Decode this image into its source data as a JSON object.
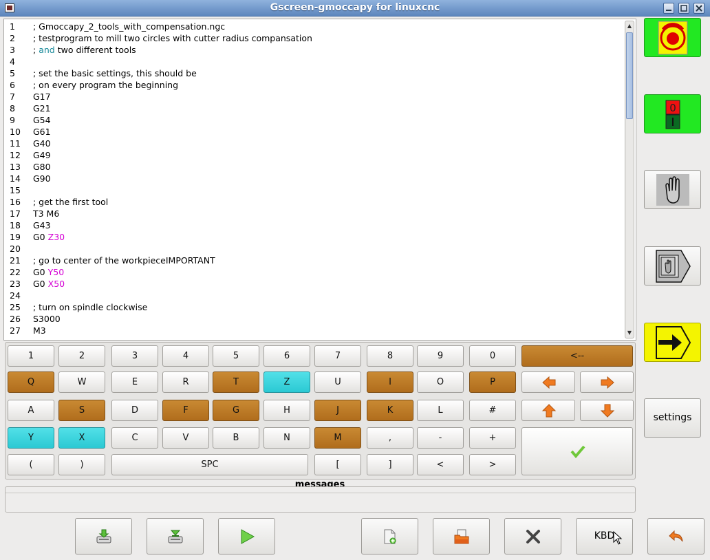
{
  "window": {
    "title": "Gscreen-gmoccapy for linuxcnc"
  },
  "editor": {
    "lines": [
      {
        "n": "1",
        "segs": [
          {
            "t": "; Gmoccapy_2_tools_with_compensation.ngc",
            "c": ""
          }
        ]
      },
      {
        "n": "2",
        "segs": [
          {
            "t": "; testprogram to mill two circles with cutter radius compansation",
            "c": ""
          }
        ]
      },
      {
        "n": "3",
        "segs": [
          {
            "t": "; ",
            "c": ""
          },
          {
            "t": "and",
            "c": "t"
          },
          {
            "t": " two different tools",
            "c": ""
          }
        ]
      },
      {
        "n": "4",
        "segs": [
          {
            "t": "",
            "c": ""
          }
        ]
      },
      {
        "n": "5",
        "segs": [
          {
            "t": "; set the basic settings, this should be",
            "c": ""
          }
        ]
      },
      {
        "n": "6",
        "segs": [
          {
            "t": "; on every program the beginning",
            "c": ""
          }
        ]
      },
      {
        "n": "7",
        "segs": [
          {
            "t": "G17",
            "c": ""
          }
        ]
      },
      {
        "n": "8",
        "segs": [
          {
            "t": "G21",
            "c": ""
          }
        ]
      },
      {
        "n": "9",
        "segs": [
          {
            "t": "G54",
            "c": ""
          }
        ]
      },
      {
        "n": "10",
        "segs": [
          {
            "t": "G61",
            "c": ""
          }
        ]
      },
      {
        "n": "11",
        "segs": [
          {
            "t": "G40",
            "c": ""
          }
        ]
      },
      {
        "n": "12",
        "segs": [
          {
            "t": "G49",
            "c": ""
          }
        ]
      },
      {
        "n": "13",
        "segs": [
          {
            "t": "G80",
            "c": ""
          }
        ]
      },
      {
        "n": "14",
        "segs": [
          {
            "t": "G90",
            "c": ""
          }
        ]
      },
      {
        "n": "15",
        "segs": [
          {
            "t": "",
            "c": ""
          }
        ]
      },
      {
        "n": "16",
        "segs": [
          {
            "t": "; get the first tool",
            "c": ""
          }
        ]
      },
      {
        "n": "17",
        "segs": [
          {
            "t": "T3 M6",
            "c": ""
          }
        ]
      },
      {
        "n": "18",
        "segs": [
          {
            "t": "G43",
            "c": ""
          }
        ]
      },
      {
        "n": "19",
        "segs": [
          {
            "t": "G0 ",
            "c": ""
          },
          {
            "t": "Z30",
            "c": "m"
          }
        ]
      },
      {
        "n": "20",
        "segs": [
          {
            "t": "",
            "c": ""
          }
        ]
      },
      {
        "n": "21",
        "segs": [
          {
            "t": "; go to center of the workpieceIMPORTANT",
            "c": ""
          }
        ]
      },
      {
        "n": "22",
        "segs": [
          {
            "t": "G0 ",
            "c": ""
          },
          {
            "t": "Y50",
            "c": "m"
          }
        ]
      },
      {
        "n": "23",
        "segs": [
          {
            "t": "G0 ",
            "c": ""
          },
          {
            "t": "X50",
            "c": "m"
          }
        ]
      },
      {
        "n": "24",
        "segs": [
          {
            "t": "",
            "c": ""
          }
        ]
      },
      {
        "n": "25",
        "segs": [
          {
            "t": "; turn on spindle clockwise",
            "c": ""
          }
        ]
      },
      {
        "n": "26",
        "segs": [
          {
            "t": "S3000",
            "c": ""
          }
        ]
      },
      {
        "n": "27",
        "segs": [
          {
            "t": "M3",
            "c": ""
          }
        ]
      }
    ]
  },
  "keyboard": {
    "row1": [
      "1",
      "2",
      "3",
      "4",
      "5",
      "6",
      "7",
      "8",
      "9",
      "0"
    ],
    "backspace": "<--",
    "row2": [
      "Q",
      "W",
      "E",
      "R",
      "T",
      "Z",
      "U",
      "I",
      "O",
      "P"
    ],
    "row3": [
      "A",
      "S",
      "D",
      "F",
      "G",
      "H",
      "J",
      "K",
      "L",
      "#"
    ],
    "row4": [
      "Y",
      "X",
      "C",
      "V",
      "B",
      "N",
      "M",
      ",",
      "-",
      "+"
    ],
    "row5_left": [
      "(",
      ")"
    ],
    "space": "SPC",
    "row5_right": [
      "[",
      "]",
      "<",
      ">"
    ],
    "colors": {
      "brown": "#b87722",
      "cyan": "#36d4dd",
      "arrow": "#f07a20"
    }
  },
  "messages": {
    "label": "messages"
  },
  "side": {
    "settings_label": "settings"
  },
  "bottom": {
    "kbd_label": "KBD"
  },
  "colors": {
    "green": "#22e822",
    "yellow": "#f4f400"
  }
}
